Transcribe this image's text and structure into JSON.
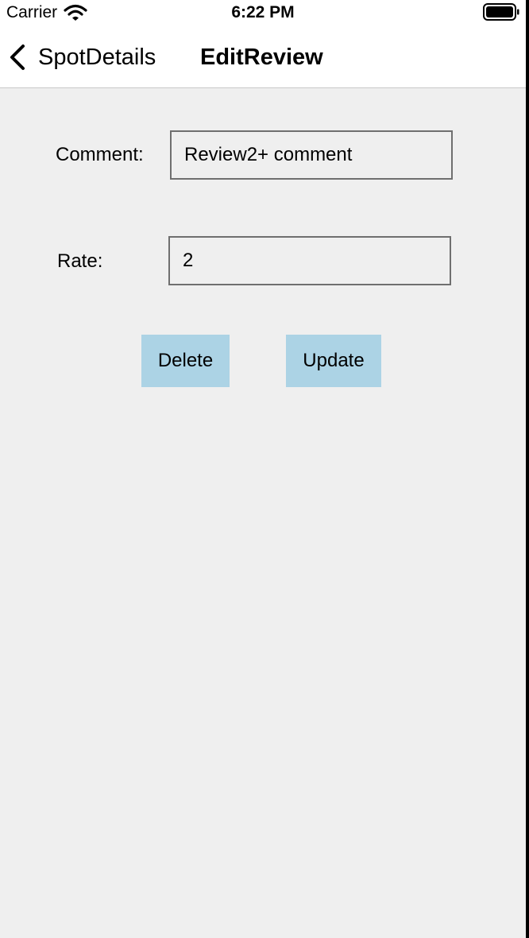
{
  "status_bar": {
    "carrier": "Carrier",
    "time": "6:22 PM",
    "icons": [
      "wifi-icon",
      "battery-icon"
    ]
  },
  "nav": {
    "back_label": "SpotDetails",
    "back_icon": "chevron-left-icon",
    "title": "EditReview"
  },
  "form": {
    "comment_label": "Comment:",
    "comment_value": "Review2+ comment",
    "rate_label": "Rate:",
    "rate_value": "2"
  },
  "actions": {
    "delete_label": "Delete",
    "update_label": "Update"
  },
  "colors": {
    "background": "#efefef",
    "header": "#ffffff",
    "button": "#acd3e5",
    "input_border": "#6f6f6f"
  }
}
